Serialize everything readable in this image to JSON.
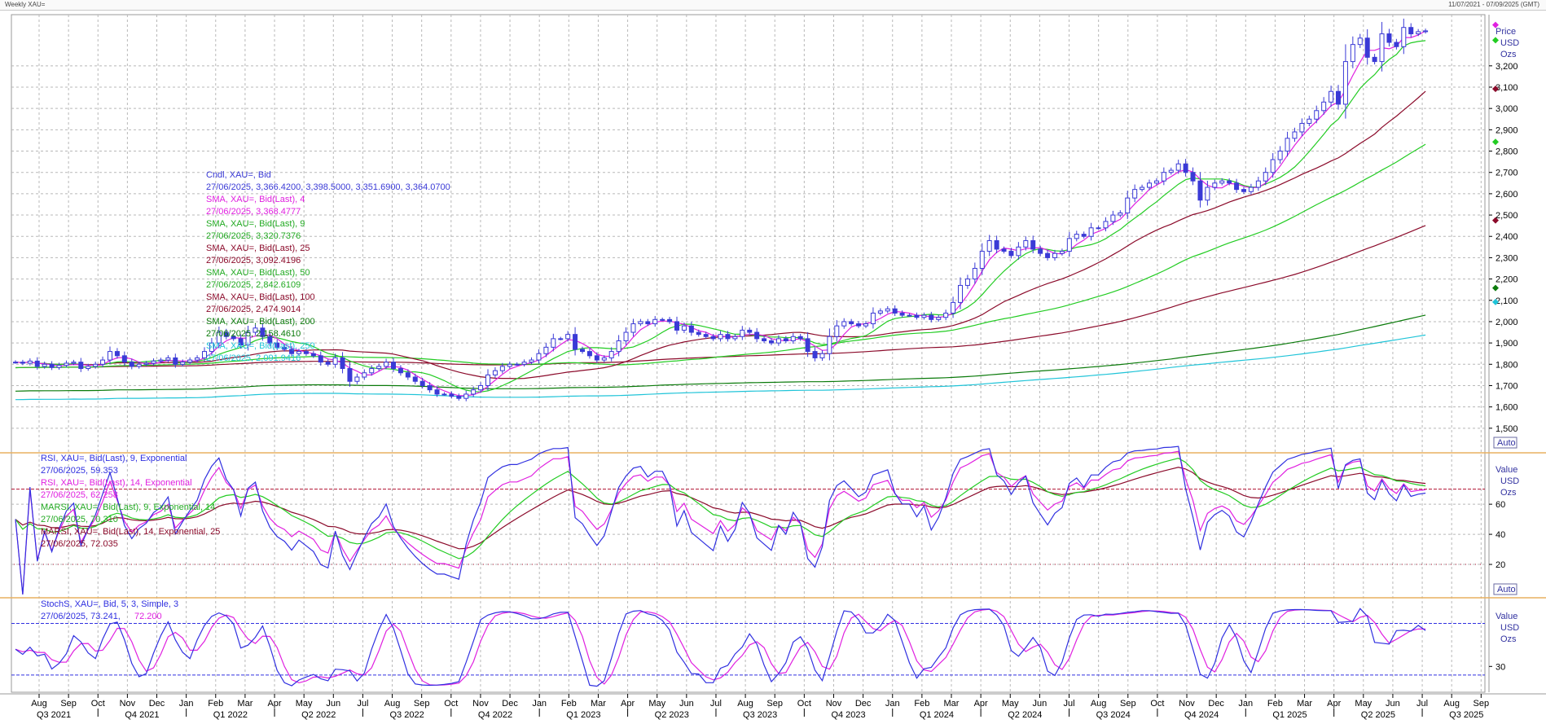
{
  "window": {
    "title": "Weekly XAU=",
    "date_range": "11/07/2021 - 07/09/2025 (GMT)"
  },
  "colors": {
    "candle": "#3a3ad6",
    "sma4": "#e020e0",
    "sma9": "#22cc22",
    "sma25": "#8b0a2a",
    "sma50": "#22cc22",
    "sma100": "#8b0a2a",
    "sma200": "#0a7a0a",
    "sma250": "#20c4d8",
    "rsi9": "#3030e0",
    "rsi14": "#e020e0",
    "marsi9": "#22cc22",
    "marsi14": "#8b0a2a",
    "stoch_k": "#3030e0",
    "stoch_d": "#e020e0",
    "grid": "#b8b8b8",
    "separator": "#e8b060",
    "level_red": "#b01030",
    "level_blue": "#3030e0"
  },
  "panels": {
    "price": {
      "axis_title": "Price",
      "axis_unit": "USD",
      "axis_unit2": "Ozs",
      "auto_label": "Auto",
      "ticks": [
        1500,
        1600,
        1700,
        1800,
        1900,
        2000,
        2100,
        2200,
        2300,
        2400,
        2500,
        2600,
        2700,
        2800,
        2900,
        3000,
        3100,
        3200
      ],
      "tick_labels": [
        "1,500",
        "1,600",
        "1,700",
        "1,800",
        "1,900",
        "2,000",
        "2,100",
        "2,200",
        "2,300",
        "2,400",
        "2,500",
        "2,600",
        "2,700",
        "2,800",
        "2,900",
        "3,000",
        "3,100",
        "3,200"
      ],
      "ylim": [
        1400,
        3440
      ],
      "markers": [
        {
          "value": 3392,
          "color": "#e020e0"
        },
        {
          "value": 3320,
          "color": "#22cc22"
        },
        {
          "value": 3092,
          "color": "#8b0a2a"
        },
        {
          "value": 2843,
          "color": "#22cc22"
        },
        {
          "value": 2475,
          "color": "#8b0a2a"
        },
        {
          "value": 2158,
          "color": "#0a7a0a"
        },
        {
          "value": 2092,
          "color": "#20c4d8"
        }
      ]
    },
    "rsi": {
      "axis_title": "Value",
      "axis_unit": "USD",
      "axis_unit2": "Ozs",
      "auto_label": "Auto",
      "ticks": [
        20,
        40,
        60
      ],
      "tick_labels": [
        "20",
        "40",
        "60"
      ],
      "ylim": [
        0,
        92
      ],
      "levels": [
        20,
        70
      ]
    },
    "stoch": {
      "axis_title": "Value",
      "axis_unit": "USD",
      "axis_unit2": "Ozs",
      "ticks": [
        30
      ],
      "tick_labels": [
        "30"
      ],
      "ylim": [
        0,
        106
      ],
      "levels": [
        20,
        80
      ]
    }
  },
  "legend_price": [
    {
      "text": "Cndl, XAU=, Bid",
      "color": "#3a3ad6"
    },
    {
      "text": "27/06/2025, 3,366.4200, 3,398.5000, 3,351.6900, 3,364.0700",
      "color": "#3a3ad6"
    },
    {
      "text": "SMA, XAU=, Bid(Last),  4",
      "color": "#e020e0"
    },
    {
      "text": "27/06/2025, 3,368.4777",
      "color": "#e020e0"
    },
    {
      "text": "SMA, XAU=, Bid(Last),  9",
      "color": "#22aa22"
    },
    {
      "text": "27/06/2025, 3,320.7376",
      "color": "#22aa22"
    },
    {
      "text": "SMA, XAU=, Bid(Last),  25",
      "color": "#8b0a2a"
    },
    {
      "text": "27/06/2025, 3,092.4196",
      "color": "#8b0a2a"
    },
    {
      "text": "SMA, XAU=, Bid(Last),  50",
      "color": "#22aa22"
    },
    {
      "text": "27/06/2025, 2,842.6109",
      "color": "#22aa22"
    },
    {
      "text": "SMA, XAU=, Bid(Last),  100",
      "color": "#8b0a2a"
    },
    {
      "text": "27/06/2025, 2,474.9014",
      "color": "#8b0a2a"
    },
    {
      "text": "SMA, XAU=, Bid(Last),  200",
      "color": "#0a7a0a"
    },
    {
      "text": "27/06/2025, 2,158.4610",
      "color": "#0a7a0a"
    },
    {
      "text": "SMA, XAU=, Bid(Last),  250",
      "color": "#20c4d8"
    },
    {
      "text": "27/06/2025, 2,091.9416",
      "color": "#20c4d8"
    }
  ],
  "legend_rsi": [
    {
      "text": "RSI, XAU=, Bid(Last),  9, Exponential",
      "color": "#3030e0"
    },
    {
      "text": "27/06/2025, 59.353",
      "color": "#3030e0"
    },
    {
      "text": "RSI, XAU=, Bid(Last),  14, Exponential",
      "color": "#e020e0"
    },
    {
      "text": "27/06/2025, 62.258",
      "color": "#e020e0"
    },
    {
      "text": "MARSI, XAU=, Bid(Last),  9, Exponential, 14",
      "color": "#22aa22"
    },
    {
      "text": "27/06/2025, 70.310",
      "color": "#22aa22"
    },
    {
      "text": "MARSI, XAU=, Bid(Last),  14, Exponential, 25",
      "color": "#8b0a2a"
    },
    {
      "text": "27/06/2025, 72.035",
      "color": "#8b0a2a"
    }
  ],
  "legend_stoch": [
    {
      "text": "StochS, XAU=, Bid,  5, 3, Simple, 3",
      "color": "#3030e0"
    },
    {
      "text": "27/06/2025, 73.241, ",
      "color": "#3030e0"
    },
    {
      "text": "72.200",
      "color": "#e020e0"
    }
  ],
  "x_axis": {
    "months": [
      "Aug",
      "Sep",
      "Oct",
      "Nov",
      "Dec",
      "Jan",
      "Feb",
      "Mar",
      "Apr",
      "May",
      "Jun",
      "Jul",
      "Aug",
      "Sep",
      "Oct",
      "Nov",
      "Dec",
      "Jan",
      "Feb",
      "Mar",
      "Apr",
      "May",
      "Jun",
      "Jul",
      "Aug",
      "Sep",
      "Oct",
      "Nov",
      "Dec",
      "Jan",
      "Feb",
      "Mar",
      "Apr",
      "May",
      "Jun",
      "Jul",
      "Aug",
      "Sep",
      "Oct",
      "Nov",
      "Dec",
      "Jan",
      "Feb",
      "Mar",
      "Apr",
      "May",
      "Jun",
      "Jul",
      "Aug",
      "Sep"
    ],
    "quarters": [
      "Q3 2021",
      "Q4 2021",
      "Q1 2022",
      "Q2 2022",
      "Q3 2022",
      "Q4 2022",
      "Q1 2023",
      "Q2 2023",
      "Q3 2023",
      "Q4 2023",
      "Q1 2024",
      "Q2 2024",
      "Q3 2024",
      "Q4 2024",
      "Q1 2025",
      "Q2 2025",
      "Q3 2025"
    ]
  },
  "chart_data": {
    "type": "line",
    "series_price_close": [
      1810,
      1805,
      1815,
      1790,
      1800,
      1785,
      1795,
      1805,
      1810,
      1780,
      1790,
      1800,
      1820,
      1860,
      1840,
      1810,
      1790,
      1800,
      1805,
      1815,
      1820,
      1830,
      1800,
      1810,
      1820,
      1830,
      1860,
      1900,
      1950,
      1930,
      1920,
      1890,
      1950,
      1970,
      1930,
      1900,
      1880,
      1870,
      1850,
      1860,
      1850,
      1840,
      1810,
      1800,
      1830,
      1780,
      1720,
      1740,
      1760,
      1780,
      1790,
      1810,
      1780,
      1760,
      1740,
      1720,
      1700,
      1680,
      1660,
      1660,
      1650,
      1640,
      1660,
      1680,
      1700,
      1750,
      1770,
      1790,
      1800,
      1800,
      1810,
      1820,
      1850,
      1880,
      1920,
      1920,
      1940,
      1870,
      1860,
      1840,
      1820,
      1830,
      1860,
      1910,
      1950,
      1990,
      2000,
      1990,
      2010,
      2010,
      2000,
      1960,
      1980,
      1950,
      1940,
      1930,
      1920,
      1940,
      1920,
      1930,
      1960,
      1950,
      1920,
      1910,
      1900,
      1920,
      1910,
      1930,
      1920,
      1860,
      1830,
      1850,
      1930,
      1980,
      2000,
      1990,
      1980,
      1990,
      2040,
      2050,
      2060,
      2040,
      2030,
      2030,
      2020,
      2030,
      2010,
      2020,
      2040,
      2090,
      2170,
      2200,
      2250,
      2330,
      2380,
      2340,
      2330,
      2310,
      2350,
      2380,
      2340,
      2320,
      2300,
      2320,
      2330,
      2390,
      2410,
      2400,
      2440,
      2440,
      2470,
      2500,
      2510,
      2580,
      2620,
      2630,
      2650,
      2660,
      2700,
      2710,
      2740,
      2700,
      2660,
      2570,
      2630,
      2650,
      2660,
      2650,
      2620,
      2610,
      2630,
      2660,
      2700,
      2760,
      2800,
      2860,
      2890,
      2930,
      2950,
      2990,
      3030,
      3080,
      3020,
      3220,
      3300,
      3330,
      3240,
      3220,
      3350,
      3310,
      3290,
      3380,
      3350,
      3360,
      3364
    ],
    "last_close": 3364.07,
    "rsi_levels": [
      20,
      70
    ],
    "stoch_levels": [
      20,
      80
    ]
  }
}
